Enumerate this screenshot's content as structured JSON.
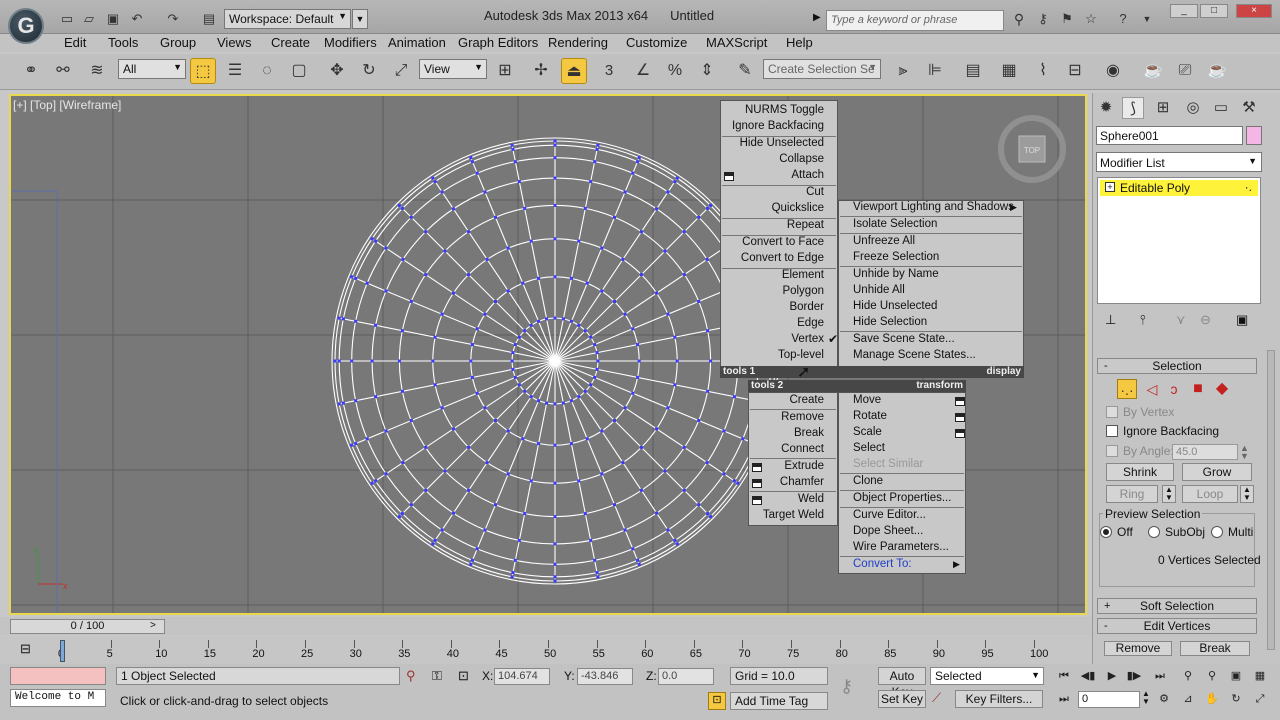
{
  "app": {
    "logo": "G",
    "workspace": "Workspace: Default",
    "title": "Autodesk 3ds Max  2013 x64",
    "file": "Untitled",
    "search_placeholder": "Type a keyword or phrase",
    "window_buttons": [
      "_",
      "□",
      "×"
    ]
  },
  "menus": [
    "Edit",
    "Tools",
    "Group",
    "Views",
    "Create",
    "Modifiers",
    "Animation",
    "Graph Editors",
    "Rendering",
    "Customize",
    "MAXScript",
    "Help"
  ],
  "toolbar": {
    "filter": "All",
    "refcoord": "View",
    "snap_label": "3",
    "named_sel": "Create Selection Se"
  },
  "viewport": {
    "label": "[+] [Top] [Wireframe]",
    "viewcube_label": "TOP",
    "axis_x": "x",
    "axis_y": "y",
    "mesh_color": "#ffffff",
    "vertex_color": "#3b3bff"
  },
  "quad": {
    "tools1": {
      "header": "tools 1",
      "items": [
        "NURMS Toggle",
        "Ignore Backfacing",
        "Hide Unselected",
        "Collapse",
        "Attach",
        "Cut",
        "Quickslice",
        "Repeat",
        "Convert to Face",
        "Convert to Edge",
        "Element",
        "Polygon",
        "Border",
        "Edge",
        "Vertex",
        "Top-level"
      ]
    },
    "display": {
      "header": "display",
      "items": [
        "Viewport Lighting and Shadows",
        "Isolate Selection",
        "Unfreeze All",
        "Freeze Selection",
        "Unhide by Name",
        "Unhide All",
        "Hide Unselected",
        "Hide Selection",
        "Save Scene State...",
        "Manage Scene States..."
      ]
    },
    "tools2": {
      "header": "tools 2",
      "items": [
        "Create",
        "Remove",
        "Break",
        "Connect",
        "Extrude",
        "Chamfer",
        "Weld",
        "Target Weld"
      ]
    },
    "transform": {
      "header": "transform",
      "items": [
        "Move",
        "Rotate",
        "Scale",
        "Select",
        "Select Similar",
        "Clone",
        "Object Properties...",
        "Curve Editor...",
        "Dope Sheet...",
        "Wire Parameters...",
        "Convert To:"
      ]
    }
  },
  "command_panel": {
    "object_name": "Sphere001",
    "object_color": "#f4b6e6",
    "modifier_list": "Modifier List",
    "stack_item": "Editable Poly",
    "selection": {
      "title": "Selection",
      "by_vertex": "By Vertex",
      "ignore_backfacing": "Ignore Backfacing",
      "by_angle": "By Angle:",
      "angle_value": "45.0",
      "shrink": "Shrink",
      "grow": "Grow",
      "ring": "Ring",
      "loop": "Loop",
      "preview_title": "Preview Selection",
      "preview_off": "Off",
      "preview_subobj": "SubObj",
      "preview_multi": "Multi",
      "status": "0 Vertices Selected"
    },
    "soft_selection": "Soft Selection",
    "edit_vertices": "Edit Vertices",
    "remove": "Remove",
    "break": "Break"
  },
  "timeline": {
    "slider": "0 / 100",
    "ticks": [
      "0",
      "5",
      "10",
      "15",
      "20",
      "25",
      "30",
      "35",
      "40",
      "45",
      "50",
      "55",
      "60",
      "65",
      "70",
      "75",
      "80",
      "85",
      "90",
      "95",
      "100"
    ]
  },
  "status": {
    "maxscript": "Welcome to M",
    "selected": "1 Object Selected",
    "prompt": "Click or click-and-drag to select objects",
    "x_label": "X:",
    "x_value": "104.674",
    "y_label": "Y:",
    "y_value": "-43.846",
    "z_label": "Z:",
    "z_value": "0.0",
    "grid": "Grid = 10.0",
    "add_time_tag": "Add Time Tag",
    "auto_key": "Auto Key",
    "set_key": "Set Key",
    "key_mode": "Selected",
    "key_filters": "Key Filters...",
    "frame": "0"
  }
}
